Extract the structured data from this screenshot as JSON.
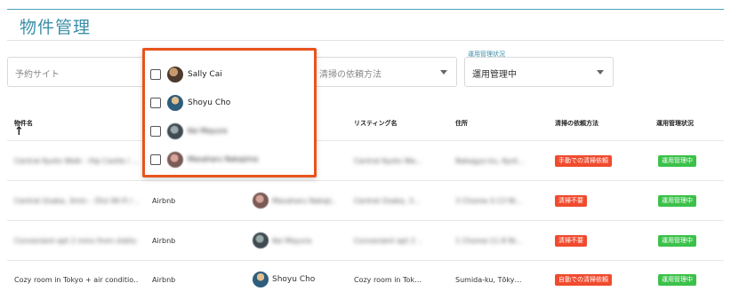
{
  "page": {
    "title": "物件管理"
  },
  "filters": {
    "site_placeholder": "予約サイト",
    "cleaning_placeholder": "清掃の依頼方法",
    "status_label": "運用管理状況",
    "status_value": "運用管理中"
  },
  "dropdown": {
    "options": [
      {
        "name": "Sally Cai",
        "checked": false,
        "avatar": "avatar-photo"
      },
      {
        "name": "Shoyu Cho",
        "checked": false,
        "avatar": "avatar-photo"
      },
      {
        "name": "Kei Mayura",
        "checked": false,
        "avatar": "avatar-photo"
      },
      {
        "name": "Masaharu Nakajima",
        "checked": false,
        "avatar": "avatar-photo"
      }
    ]
  },
  "table": {
    "columns": {
      "property": "物件名",
      "listing": "リスティング名",
      "address": "住所",
      "cleaning": "清掃の依頼方法",
      "status": "運用管理状況"
    },
    "rows": [
      {
        "property": "Central Kyoto Walk - Hip Castle / ...",
        "site": "",
        "manager": "",
        "listing": "Central Kyoto Wa...",
        "address": "Nakagyo-ku, Kyot...",
        "cleaning": "手動での清掃依頼",
        "cleaning_color": "#f04b2e",
        "status": "運用管理中",
        "status_color": "#3cc14a"
      },
      {
        "property": "Central Osaka, 3min - 35sl Wi-Fi / ...",
        "site": "Airbnb",
        "manager": "Masaharu Nakaji...",
        "listing": "Central Osaka, 3...",
        "address": "3 Chome-3-13 Ni...",
        "cleaning": "清掃不要",
        "cleaning_color": "#f04b2e",
        "status": "運用管理中",
        "status_color": "#3cc14a"
      },
      {
        "property": "Convenient apt 2 mins from statio...",
        "site": "Airbnb",
        "manager": "Kei Mayura",
        "listing": "Convenient apt 2 ...",
        "address": "1 Chome-11-8 Ni...",
        "cleaning": "清掃不要",
        "cleaning_color": "#f04b2e",
        "status": "運用管理中",
        "status_color": "#3cc14a"
      },
      {
        "property": "Cozy room in Tokyo + air conditio…",
        "site": "Airbnb",
        "manager": "Shoyu Cho",
        "listing": "Cozy room in Tok…",
        "address": "Sumida-ku, Tōky…",
        "cleaning": "自動での清掃依頼",
        "cleaning_color": "#f04b2e",
        "status": "運用管理中",
        "status_color": "#3cc14a"
      }
    ]
  },
  "colors": {
    "accent": "#3a8fa8",
    "highlight_border": "#e8541c",
    "badge_red": "#f04b2e",
    "badge_green": "#3cc14a"
  },
  "icons": {
    "sort": "arrow-up-icon",
    "dropdown": "caret-down-icon"
  }
}
